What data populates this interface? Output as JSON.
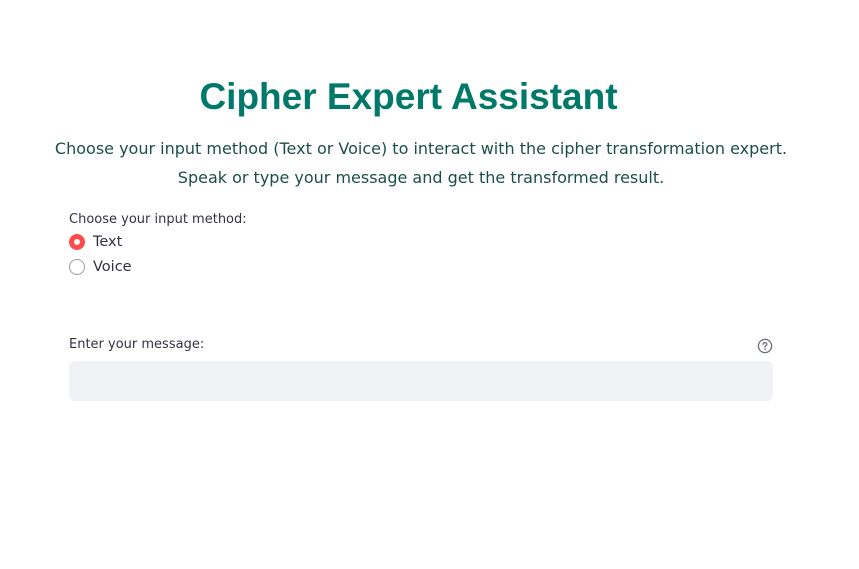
{
  "app": {
    "title": "Cipher Expert Assistant",
    "subtitle_line1": "Choose your input method (Text or Voice) to interact with the cipher transformation expert.",
    "subtitle_line2": "Speak or type your message and get the transformed result."
  },
  "input_method": {
    "label": "Choose your input method:",
    "options": [
      {
        "label": "Text",
        "selected": true
      },
      {
        "label": "Voice",
        "selected": false
      }
    ]
  },
  "message": {
    "label": "Enter your message:",
    "value": "",
    "placeholder": "",
    "help_icon": "question-circle-icon"
  },
  "colors": {
    "title": "#00796b",
    "subtitle": "#1b4e4a",
    "radio_selected": "#ff4b4b",
    "input_bg": "#f0f2f6"
  }
}
